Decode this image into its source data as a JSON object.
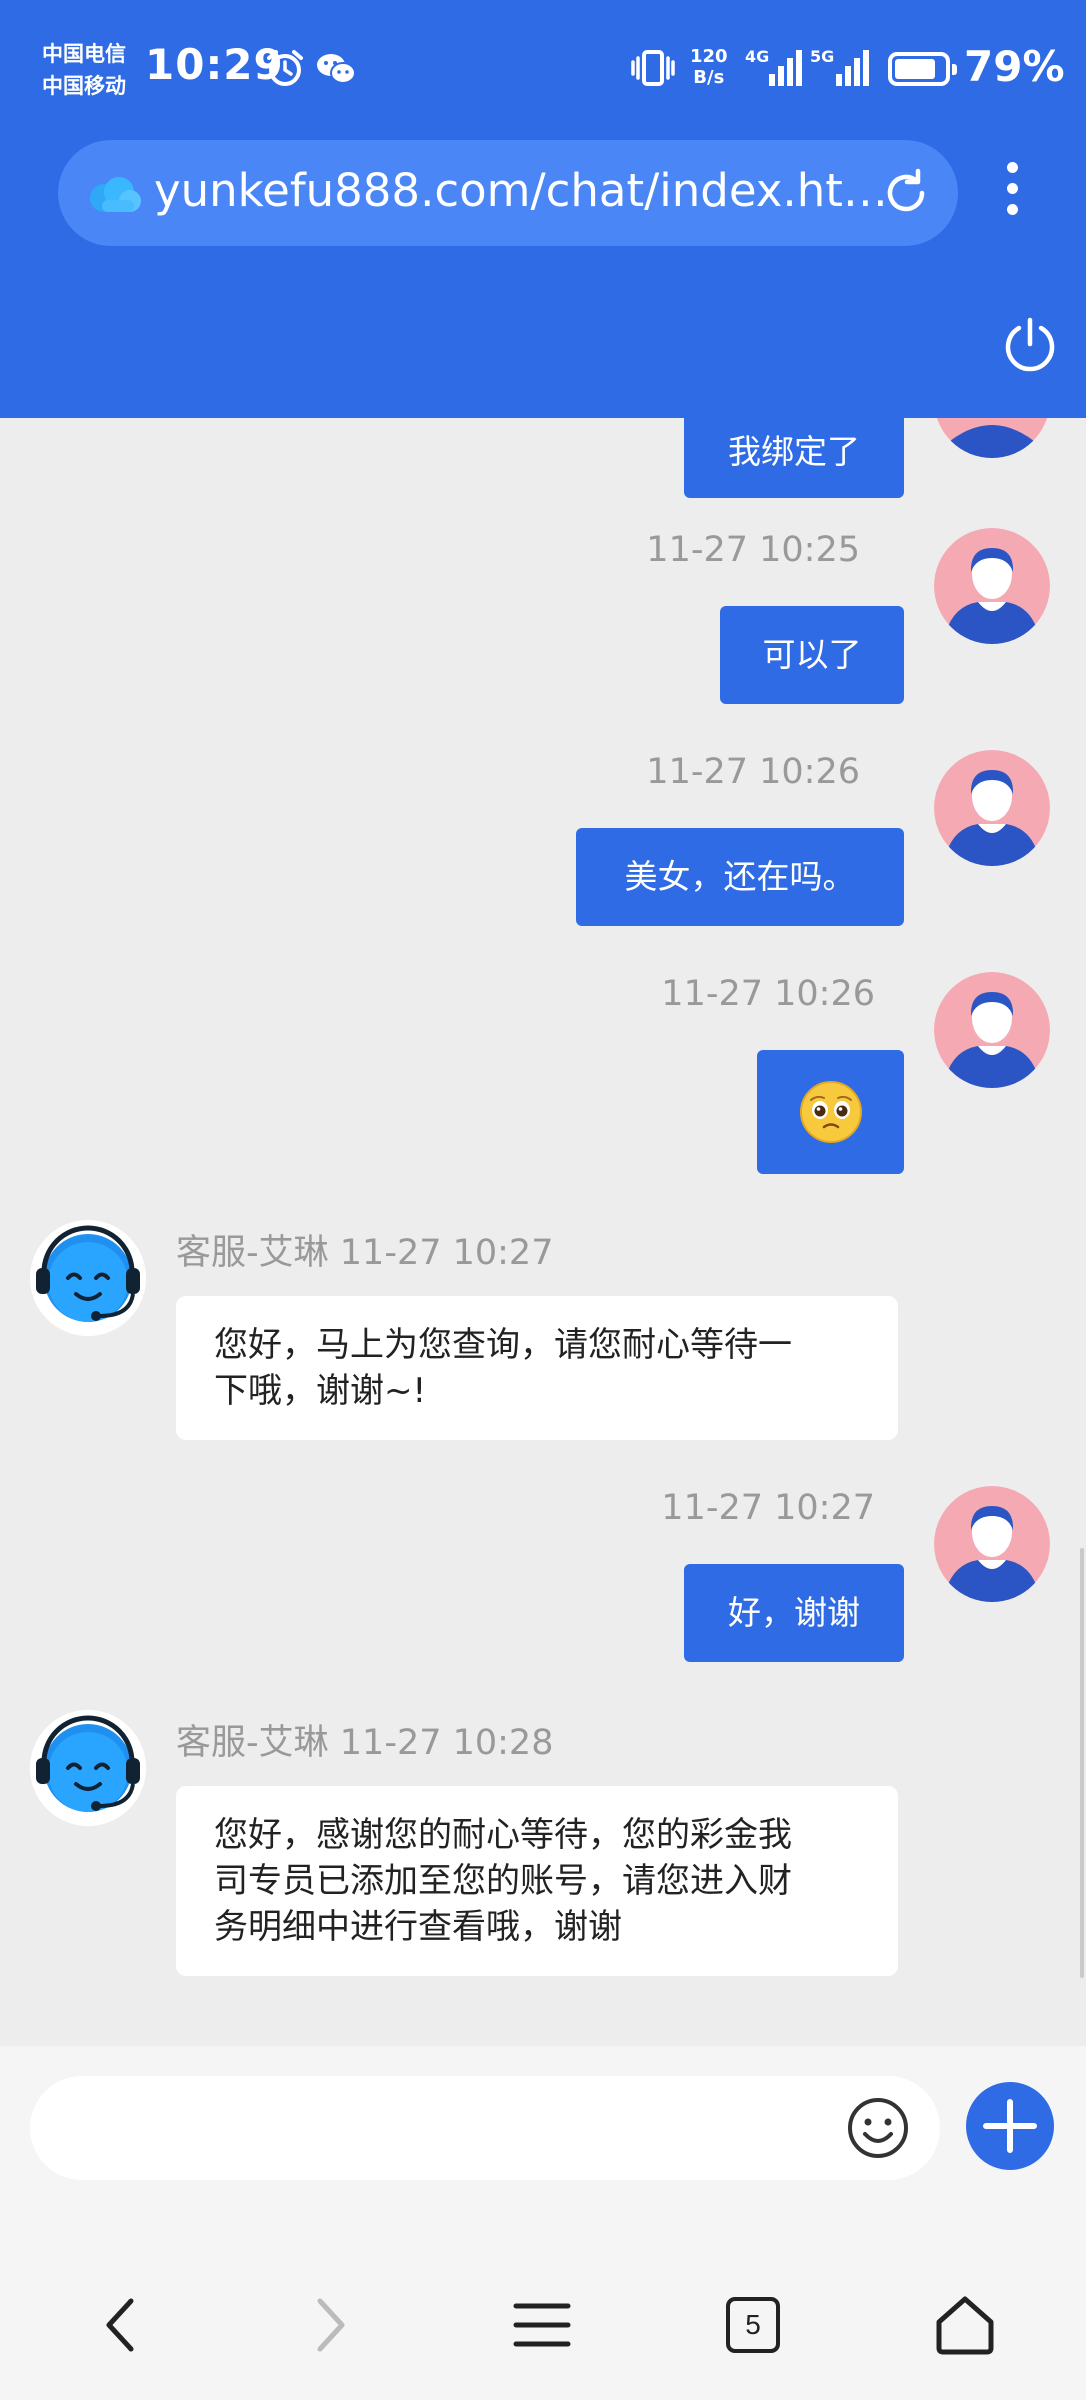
{
  "status_bar": {
    "carrier_1": "中国电信",
    "carrier_2": "中国移动",
    "time": "10:29",
    "net_speed_value": "120",
    "net_speed_unit": "B/s",
    "sig1_label": "4G",
    "sig2_label": "5G",
    "battery_percent": "79%",
    "battery_level": 0.79
  },
  "browser": {
    "url": "yunkefu888.com/chat/index.ht…",
    "icons": [
      "cloud-icon",
      "reload-icon",
      "more-menu-icon",
      "power-icon"
    ]
  },
  "chat": {
    "messages": [
      {
        "side": "out",
        "time": "",
        "text": "我绑定了"
      },
      {
        "side": "out",
        "time": "11-27 10:25",
        "text": "可以了"
      },
      {
        "side": "out",
        "time": "11-27 10:26",
        "text": "美女，还在吗。"
      },
      {
        "side": "out",
        "time": "11-27 10:26",
        "text": "🥺",
        "is_emoji": true
      },
      {
        "side": "in",
        "sender": "客服-艾琳",
        "time": "11-27 10:27",
        "line1": "您好，马上为您查询，请您耐心等待一",
        "line2": "下哦，谢谢~!"
      },
      {
        "side": "out",
        "time": "11-27 10:27",
        "text": "好，谢谢"
      },
      {
        "side": "in",
        "sender": "客服-艾琳",
        "time": "11-27 10:28",
        "line1": "您好，感谢您的耐心等待，您的彩金我",
        "line2": "司专员已添加至您的账号，请您进入财",
        "line3": "务明细中进行查看哦，谢谢"
      }
    ]
  },
  "input": {
    "placeholder": "",
    "value": ""
  },
  "navbar": {
    "tab_count": "5"
  },
  "colors": {
    "brand_blue": "#2e6be5",
    "chat_bg": "#ededed",
    "user_avatar_bg": "#f4a9b3"
  }
}
